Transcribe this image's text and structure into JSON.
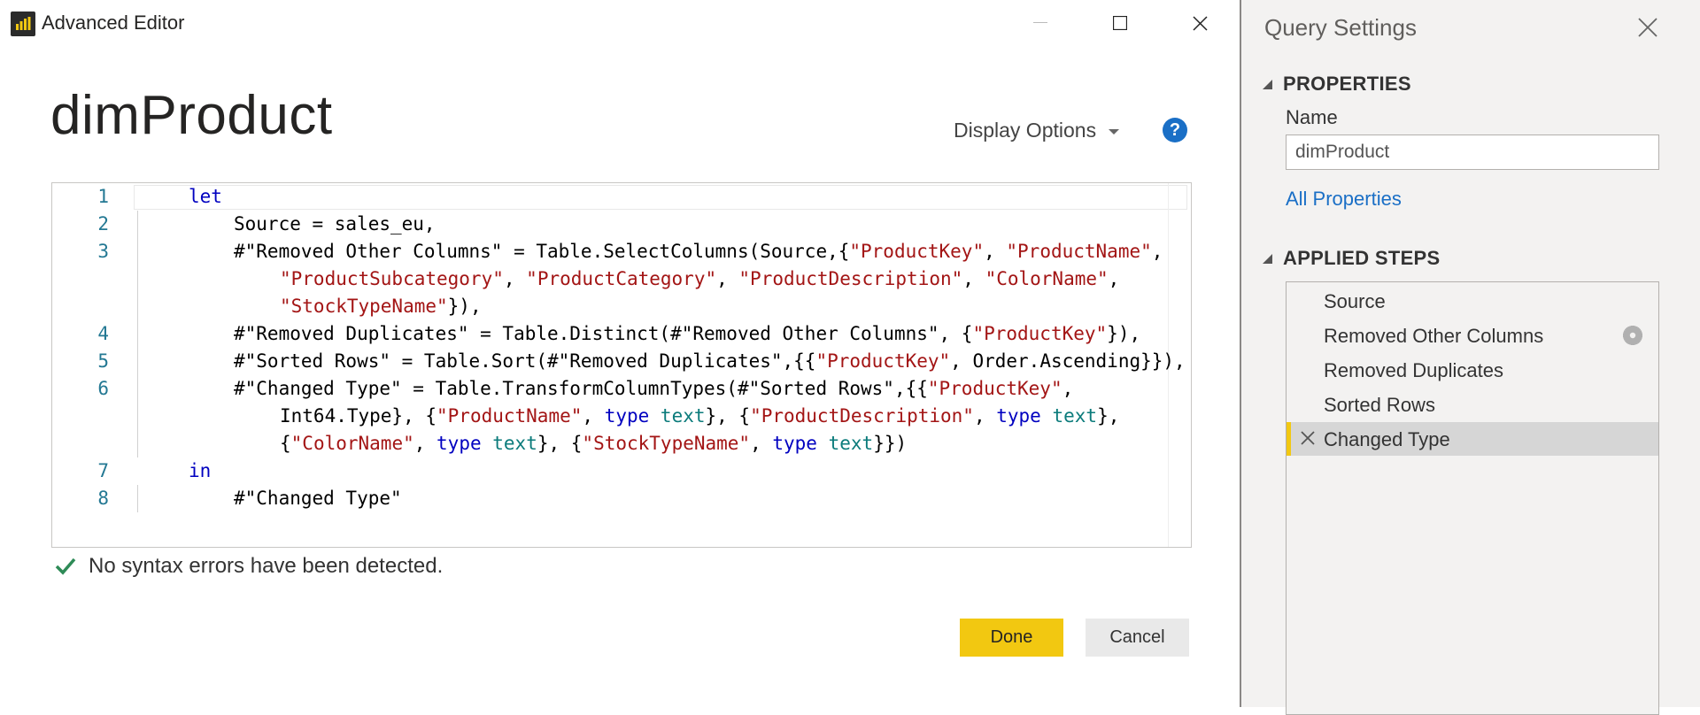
{
  "window": {
    "title": "Advanced Editor",
    "app_icon": "power-bi-icon"
  },
  "editor": {
    "query_name": "dimProduct",
    "display_options_label": "Display Options",
    "help_icon": "question-icon",
    "lines": [
      {
        "num": "1",
        "indent": 0,
        "tokens": [
          {
            "t": "let",
            "c": "kw"
          }
        ]
      },
      {
        "num": "2",
        "indent": 1,
        "tokens": [
          {
            "t": "Source = sales_eu,",
            "c": ""
          }
        ]
      },
      {
        "num": "3",
        "indent": 1,
        "tokens": [
          {
            "t": "#\"Removed Other Columns\" = Table.SelectColumns(Source,{",
            "c": ""
          },
          {
            "t": "\"ProductKey\"",
            "c": "str"
          },
          {
            "t": ", ",
            "c": ""
          },
          {
            "t": "\"ProductName\"",
            "c": "str"
          },
          {
            "t": ",",
            "c": ""
          }
        ]
      },
      {
        "num": "",
        "indent": 2,
        "tokens": [
          {
            "t": "\"ProductSubcategory\"",
            "c": "str"
          },
          {
            "t": ", ",
            "c": ""
          },
          {
            "t": "\"ProductCategory\"",
            "c": "str"
          },
          {
            "t": ", ",
            "c": ""
          },
          {
            "t": "\"ProductDescription\"",
            "c": "str"
          },
          {
            "t": ", ",
            "c": ""
          },
          {
            "t": "\"ColorName\"",
            "c": "str"
          },
          {
            "t": ",",
            "c": ""
          }
        ]
      },
      {
        "num": "",
        "indent": 2,
        "tokens": [
          {
            "t": "\"StockTypeName\"",
            "c": "str"
          },
          {
            "t": "}),",
            "c": ""
          }
        ]
      },
      {
        "num": "4",
        "indent": 1,
        "tokens": [
          {
            "t": "#\"Removed Duplicates\" = Table.Distinct(#\"Removed Other Columns\", {",
            "c": ""
          },
          {
            "t": "\"ProductKey\"",
            "c": "str"
          },
          {
            "t": "}),",
            "c": ""
          }
        ]
      },
      {
        "num": "5",
        "indent": 1,
        "tokens": [
          {
            "t": "#\"Sorted Rows\" = Table.Sort(#\"Removed Duplicates\",{{",
            "c": ""
          },
          {
            "t": "\"ProductKey\"",
            "c": "str"
          },
          {
            "t": ", Order.Ascending}}),",
            "c": ""
          }
        ]
      },
      {
        "num": "6",
        "indent": 1,
        "tokens": [
          {
            "t": "#\"Changed Type\" = Table.TransformColumnTypes(#\"Sorted Rows\",{{",
            "c": ""
          },
          {
            "t": "\"ProductKey\"",
            "c": "str"
          },
          {
            "t": ",",
            "c": ""
          }
        ]
      },
      {
        "num": "",
        "indent": 2,
        "tokens": [
          {
            "t": "Int64.Type}, {",
            "c": ""
          },
          {
            "t": "\"ProductName\"",
            "c": "str"
          },
          {
            "t": ", ",
            "c": ""
          },
          {
            "t": "type",
            "c": "kw"
          },
          {
            "t": " ",
            "c": ""
          },
          {
            "t": "text",
            "c": "typ"
          },
          {
            "t": "}, {",
            "c": ""
          },
          {
            "t": "\"ProductDescription\"",
            "c": "str"
          },
          {
            "t": ", ",
            "c": ""
          },
          {
            "t": "type",
            "c": "kw"
          },
          {
            "t": " ",
            "c": ""
          },
          {
            "t": "text",
            "c": "typ"
          },
          {
            "t": "},",
            "c": ""
          }
        ]
      },
      {
        "num": "",
        "indent": 2,
        "tokens": [
          {
            "t": "{",
            "c": ""
          },
          {
            "t": "\"ColorName\"",
            "c": "str"
          },
          {
            "t": ", ",
            "c": ""
          },
          {
            "t": "type",
            "c": "kw"
          },
          {
            "t": " ",
            "c": ""
          },
          {
            "t": "text",
            "c": "typ"
          },
          {
            "t": "}, {",
            "c": ""
          },
          {
            "t": "\"StockTypeName\"",
            "c": "str"
          },
          {
            "t": ", ",
            "c": ""
          },
          {
            "t": "type",
            "c": "kw"
          },
          {
            "t": " ",
            "c": ""
          },
          {
            "t": "text",
            "c": "typ"
          },
          {
            "t": "}})",
            "c": ""
          }
        ]
      },
      {
        "num": "7",
        "indent": 0,
        "tokens": [
          {
            "t": "in",
            "c": "kw"
          }
        ]
      },
      {
        "num": "8",
        "indent": 1,
        "tokens": [
          {
            "t": "#\"Changed Type\"",
            "c": ""
          }
        ]
      }
    ],
    "status_icon": "checkmark-icon",
    "status_text": "No syntax errors have been detected.",
    "done_label": "Done",
    "cancel_label": "Cancel"
  },
  "query_settings": {
    "title": "Query Settings",
    "properties_header": "PROPERTIES",
    "name_label": "Name",
    "name_value": "dimProduct",
    "all_properties_link": "All Properties",
    "applied_steps_header": "APPLIED STEPS",
    "steps": [
      {
        "label": "Source",
        "selected": false,
        "gear": false
      },
      {
        "label": "Removed Other Columns",
        "selected": false,
        "gear": true
      },
      {
        "label": "Removed Duplicates",
        "selected": false,
        "gear": false
      },
      {
        "label": "Sorted Rows",
        "selected": false,
        "gear": false
      },
      {
        "label": "Changed Type",
        "selected": true,
        "gear": false
      }
    ]
  },
  "colors": {
    "accent_yellow": "#f2c811",
    "link_blue": "#1a6fc6",
    "keyword": "#0000c0",
    "string": "#a31515",
    "type_name": "#0b7b7b",
    "line_number": "#237893",
    "success_check": "#2e8b57"
  }
}
